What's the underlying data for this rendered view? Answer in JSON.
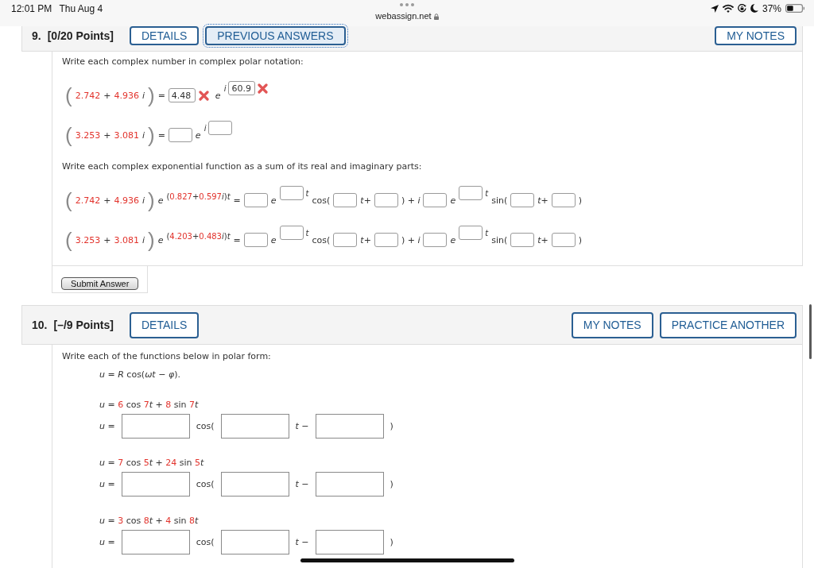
{
  "status_bar": {
    "time": "12:01 PM",
    "date": "Thu Aug 4",
    "url": "webassign.net",
    "battery": "37%"
  },
  "questions": [
    {
      "number": "9.",
      "points": "[0/20 Points]",
      "buttons": [
        {
          "label": "DETAILS",
          "focused": false
        },
        {
          "label": "PREVIOUS ANSWERS",
          "focused": true
        }
      ],
      "tools": [
        {
          "label": "MY NOTES",
          "focused": false
        }
      ],
      "sections": [
        {
          "prompt": "Write each complex number in complex polar notation:",
          "lines": [
            {
              "kind": "equation",
              "tokens": [
                {
                  "kind": "paren",
                  "text": "("
                },
                {
                  "kind": "num",
                  "text": "2.742"
                },
                {
                  "kind": "text",
                  "text": "+"
                },
                {
                  "kind": "num",
                  "text": "4.936"
                },
                {
                  "kind": "var",
                  "text": "i"
                },
                {
                  "kind": "paren",
                  "text": ")"
                },
                {
                  "kind": "text",
                  "text": "="
                },
                {
                  "kind": "field",
                  "value": "4.48",
                  "correct": false
                },
                {
                  "kind": "var",
                  "text": "e"
                },
                {
                  "kind": "sup",
                  "items": [
                    {
                      "kind": "var",
                      "text": "i"
                    },
                    {
                      "kind": "field",
                      "value": "60.9",
                      "correct": false
                    }
                  ]
                }
              ]
            },
            {
              "kind": "equation",
              "tokens": [
                {
                  "kind": "paren",
                  "text": "("
                },
                {
                  "kind": "num",
                  "text": "3.253"
                },
                {
                  "kind": "text",
                  "text": "+"
                },
                {
                  "kind": "num",
                  "text": "3.081"
                },
                {
                  "kind": "var",
                  "text": "i"
                },
                {
                  "kind": "paren",
                  "text": ")"
                },
                {
                  "kind": "text",
                  "text": "="
                },
                {
                  "kind": "field"
                },
                {
                  "kind": "var",
                  "text": "e"
                },
                {
                  "kind": "sup",
                  "items": [
                    {
                      "kind": "var",
                      "text": "i"
                    },
                    {
                      "kind": "field"
                    }
                  ]
                }
              ]
            }
          ]
        },
        {
          "prompt": "Write each complex exponential function as a sum of its real and imaginary parts:",
          "lines": [
            {
              "kind": "equation",
              "tokens": [
                {
                  "kind": "paren",
                  "text": "("
                },
                {
                  "kind": "num",
                  "text": "2.742"
                },
                {
                  "kind": "text",
                  "text": "+"
                },
                {
                  "kind": "num",
                  "text": "4.936"
                },
                {
                  "kind": "var",
                  "text": "i"
                },
                {
                  "kind": "paren",
                  "text": ")"
                },
                {
                  "kind": "var",
                  "text": "e"
                },
                {
                  "kind": "sup",
                  "items": [
                    {
                      "kind": "text",
                      "text": "("
                    },
                    {
                      "kind": "num",
                      "text": "0.827"
                    },
                    {
                      "kind": "text",
                      "text": "+"
                    },
                    {
                      "kind": "num",
                      "text": "0.597"
                    },
                    {
                      "kind": "text",
                      "text": "*i*)*t*"
                    }
                  ]
                },
                {
                  "kind": "text",
                  "text": "="
                },
                {
                  "kind": "field"
                },
                {
                  "kind": "var",
                  "text": "e"
                },
                {
                  "kind": "sup",
                  "items": [
                    {
                      "kind": "field"
                    },
                    {
                      "kind": "var",
                      "text": "t"
                    }
                  ]
                },
                {
                  "kind": "text",
                  "text": "cos("
                },
                {
                  "kind": "field"
                },
                {
                  "kind": "text",
                  "text": "*t*+"
                },
                {
                  "kind": "field"
                },
                {
                  "kind": "text",
                  "text": ") + *i*"
                },
                {
                  "kind": "field"
                },
                {
                  "kind": "var",
                  "text": "e"
                },
                {
                  "kind": "sup",
                  "items": [
                    {
                      "kind": "field"
                    },
                    {
                      "kind": "var",
                      "text": "t"
                    }
                  ]
                },
                {
                  "kind": "text",
                  "text": "sin("
                },
                {
                  "kind": "field"
                },
                {
                  "kind": "text",
                  "text": "*t*+"
                },
                {
                  "kind": "field"
                },
                {
                  "kind": "text",
                  "text": ")"
                }
              ]
            },
            {
              "kind": "equation",
              "tokens": [
                {
                  "kind": "paren",
                  "text": "("
                },
                {
                  "kind": "num",
                  "text": "3.253"
                },
                {
                  "kind": "text",
                  "text": "+"
                },
                {
                  "kind": "num",
                  "text": "3.081"
                },
                {
                  "kind": "var",
                  "text": "i"
                },
                {
                  "kind": "paren",
                  "text": ")"
                },
                {
                  "kind": "var",
                  "text": "e"
                },
                {
                  "kind": "sup",
                  "items": [
                    {
                      "kind": "text",
                      "text": "("
                    },
                    {
                      "kind": "num",
                      "text": "4.203"
                    },
                    {
                      "kind": "text",
                      "text": "+"
                    },
                    {
                      "kind": "num",
                      "text": "0.483"
                    },
                    {
                      "kind": "text",
                      "text": "*i*)*t*"
                    }
                  ]
                },
                {
                  "kind": "text",
                  "text": "="
                },
                {
                  "kind": "field"
                },
                {
                  "kind": "var",
                  "text": "e"
                },
                {
                  "kind": "sup",
                  "items": [
                    {
                      "kind": "field"
                    },
                    {
                      "kind": "var",
                      "text": "t"
                    }
                  ]
                },
                {
                  "kind": "text",
                  "text": "cos("
                },
                {
                  "kind": "field"
                },
                {
                  "kind": "text",
                  "text": "*t*+"
                },
                {
                  "kind": "field"
                },
                {
                  "kind": "text",
                  "text": ") + *i*"
                },
                {
                  "kind": "field"
                },
                {
                  "kind": "var",
                  "text": "e"
                },
                {
                  "kind": "sup",
                  "items": [
                    {
                      "kind": "field"
                    },
                    {
                      "kind": "var",
                      "text": "t"
                    }
                  ]
                },
                {
                  "kind": "text",
                  "text": "sin("
                },
                {
                  "kind": "field"
                },
                {
                  "kind": "text",
                  "text": "*t*+"
                },
                {
                  "kind": "field"
                },
                {
                  "kind": "text",
                  "text": ")"
                }
              ]
            }
          ]
        }
      ],
      "submit": "Submit Answer"
    },
    {
      "number": "10.",
      "points": "[–/9 Points]",
      "buttons": [
        {
          "label": "DETAILS",
          "focused": false
        }
      ],
      "tools": [
        {
          "label": "MY NOTES",
          "focused": false
        },
        {
          "label": "PRACTICE ANOTHER",
          "focused": false
        }
      ],
      "sections": [
        {
          "prompt": "Write each of the functions below in polar form:",
          "lines": [
            {
              "kind": "formula",
              "tokens": [
                {
                  "kind": "text",
                  "text": "*u* = *R* cos(*ωt* − *φ*)."
                }
              ]
            },
            {
              "kind": "given",
              "tokens": [
                {
                  "kind": "text",
                  "text": "*u* = "
                },
                {
                  "kind": "num",
                  "text": "6"
                },
                {
                  "kind": "text",
                  "text": " cos "
                },
                {
                  "kind": "num",
                  "text": "7"
                },
                {
                  "kind": "text",
                  "text": "*t* + "
                },
                {
                  "kind": "num",
                  "text": "8"
                },
                {
                  "kind": "text",
                  "text": " sin "
                },
                {
                  "kind": "num",
                  "text": "7"
                },
                {
                  "kind": "var",
                  "text": "t"
                }
              ]
            },
            {
              "kind": "answer",
              "tokens": [
                {
                  "kind": "text",
                  "text": "*u* ="
                },
                {
                  "kind": "field"
                },
                {
                  "kind": "text",
                  "text": "cos("
                },
                {
                  "kind": "field"
                },
                {
                  "kind": "text",
                  "text": "*t* −"
                },
                {
                  "kind": "field"
                },
                {
                  "kind": "text",
                  "text": ")"
                }
              ]
            },
            {
              "kind": "given",
              "tokens": [
                {
                  "kind": "text",
                  "text": "*u* = "
                },
                {
                  "kind": "num",
                  "text": "7"
                },
                {
                  "kind": "text",
                  "text": " cos "
                },
                {
                  "kind": "num",
                  "text": "5"
                },
                {
                  "kind": "text",
                  "text": "*t* + "
                },
                {
                  "kind": "num",
                  "text": "24"
                },
                {
                  "kind": "text",
                  "text": " sin "
                },
                {
                  "kind": "num",
                  "text": "5"
                },
                {
                  "kind": "var",
                  "text": "t"
                }
              ]
            },
            {
              "kind": "answer",
              "tokens": [
                {
                  "kind": "text",
                  "text": "*u* ="
                },
                {
                  "kind": "field"
                },
                {
                  "kind": "text",
                  "text": "cos("
                },
                {
                  "kind": "field"
                },
                {
                  "kind": "text",
                  "text": "*t* −"
                },
                {
                  "kind": "field"
                },
                {
                  "kind": "text",
                  "text": ")"
                }
              ]
            },
            {
              "kind": "given",
              "tokens": [
                {
                  "kind": "text",
                  "text": "*u* = "
                },
                {
                  "kind": "num",
                  "text": "3"
                },
                {
                  "kind": "text",
                  "text": " cos "
                },
                {
                  "kind": "num",
                  "text": "8"
                },
                {
                  "kind": "text",
                  "text": "*t* + "
                },
                {
                  "kind": "num",
                  "text": "4"
                },
                {
                  "kind": "text",
                  "text": " sin "
                },
                {
                  "kind": "num",
                  "text": "8"
                },
                {
                  "kind": "var",
                  "text": "t"
                }
              ]
            },
            {
              "kind": "answer",
              "tokens": [
                {
                  "kind": "text",
                  "text": "*u* ="
                },
                {
                  "kind": "field"
                },
                {
                  "kind": "text",
                  "text": "cos("
                },
                {
                  "kind": "field"
                },
                {
                  "kind": "text",
                  "text": "*t* −"
                },
                {
                  "kind": "field"
                },
                {
                  "kind": "text",
                  "text": ")"
                }
              ]
            }
          ]
        }
      ]
    }
  ]
}
